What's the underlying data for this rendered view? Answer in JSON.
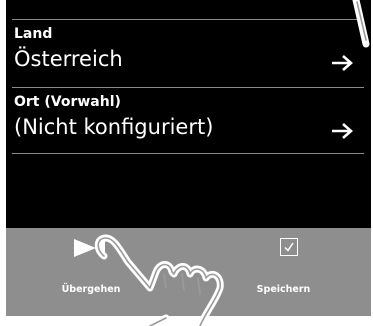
{
  "list": {
    "items": [
      {
        "label": "Land",
        "value": "Österreich"
      },
      {
        "label": "Ort (Vorwahl)",
        "value": "(Nicht konfiguriert)"
      }
    ]
  },
  "softkeys": {
    "left": {
      "label": "Übergehen",
      "icon": "skip-icon"
    },
    "right": {
      "label": "Speichern",
      "icon": "checkbox-checked-icon"
    }
  },
  "colors": {
    "screen_background": "#000000",
    "softkey_bar": "#8e8e8e",
    "text": "#ffffff",
    "divider": "#8a8a8a"
  }
}
